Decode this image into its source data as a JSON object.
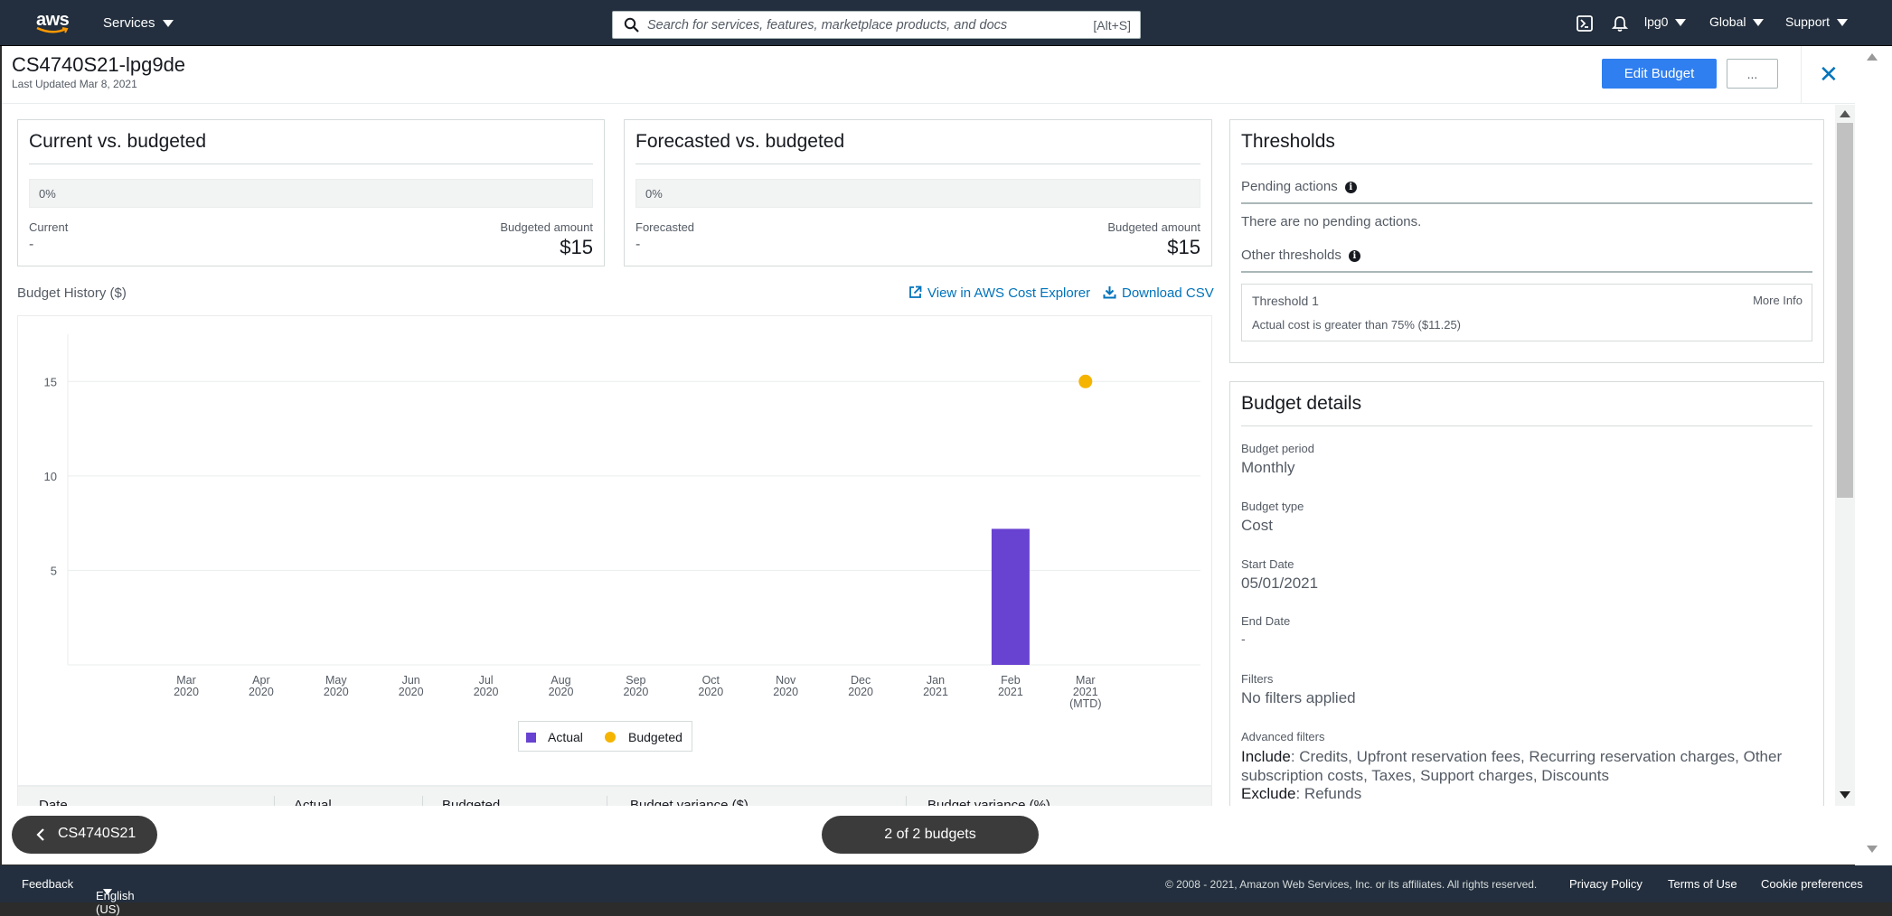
{
  "nav": {
    "logo": "aws",
    "services": "Services",
    "search_placeholder": "Search for services, features, marketplace products, and docs",
    "search_shortcut": "[Alt+S]",
    "account": "lpg0",
    "region": "Global",
    "support": "Support"
  },
  "header": {
    "title": "CS4740S21-lpg9de",
    "last_updated": "Last Updated Mar 8, 2021",
    "edit_button": "Edit Budget",
    "more_button": "..."
  },
  "current_card": {
    "title": "Current vs. budgeted",
    "progress": "0%",
    "current_label": "Current",
    "current_value": "-",
    "budget_label": "Budgeted amount",
    "budget_value": "$15"
  },
  "forecast_card": {
    "title": "Forecasted vs. budgeted",
    "progress": "0%",
    "forecast_label": "Forecasted",
    "forecast_value": "-",
    "budget_label": "Budgeted amount",
    "budget_value": "$15"
  },
  "history": {
    "title": "Budget History ($)",
    "explorer_link": "View in AWS Cost Explorer",
    "csv_link": "Download CSV"
  },
  "chart_data": {
    "type": "bar",
    "categories": [
      "Mar 2020",
      "Apr 2020",
      "May 2020",
      "Jun 2020",
      "Jul 2020",
      "Aug 2020",
      "Sep 2020",
      "Oct 2020",
      "Nov 2020",
      "Dec 2020",
      "Jan 2021",
      "Feb 2021",
      "Mar 2021 (MTD)"
    ],
    "category_lines": [
      [
        "Mar",
        "2020"
      ],
      [
        "Apr",
        "2020"
      ],
      [
        "May",
        "2020"
      ],
      [
        "Jun",
        "2020"
      ],
      [
        "Jul",
        "2020"
      ],
      [
        "Aug",
        "2020"
      ],
      [
        "Sep",
        "2020"
      ],
      [
        "Oct",
        "2020"
      ],
      [
        "Nov",
        "2020"
      ],
      [
        "Dec",
        "2020"
      ],
      [
        "Jan",
        "2021"
      ],
      [
        "Feb",
        "2021"
      ],
      [
        "Mar",
        "2021",
        "(MTD)"
      ]
    ],
    "series": [
      {
        "name": "Actual",
        "type": "bar",
        "color": "#6842d1",
        "values": [
          null,
          null,
          null,
          null,
          null,
          null,
          null,
          null,
          null,
          null,
          null,
          7.2,
          null
        ]
      },
      {
        "name": "Budgeted",
        "type": "scatter",
        "color": "#f5b400",
        "values": [
          null,
          null,
          null,
          null,
          null,
          null,
          null,
          null,
          null,
          null,
          null,
          null,
          15
        ]
      }
    ],
    "yticks": [
      5,
      10,
      15
    ],
    "ylim": [
      0,
      17.5
    ],
    "grid": true,
    "legend": "bottom-center"
  },
  "table": {
    "columns": [
      "Date",
      "Actual",
      "Budgeted",
      "Budget variance ($)",
      "Budget variance (%)"
    ]
  },
  "thresholds": {
    "title": "Thresholds",
    "pending_label": "Pending actions",
    "pending_text": "There are no pending actions.",
    "other_label": "Other thresholds",
    "threshold_name": "Threshold 1",
    "more_info": "More Info",
    "threshold_desc": "Actual cost is greater than 75% ($11.25)"
  },
  "details": {
    "title": "Budget details",
    "period_label": "Budget period",
    "period_value": "Monthly",
    "type_label": "Budget type",
    "type_value": "Cost",
    "start_label": "Start Date",
    "start_value": "05/01/2021",
    "end_label": "End Date",
    "end_value": "-",
    "filters_label": "Filters",
    "filters_value": "No filters applied",
    "adv_label": "Advanced filters",
    "include_label": "Include",
    "include_value": ": Credits, Upfront reservation fees, Recurring reservation charges, Other subscription costs, Taxes, Support charges, Discounts",
    "exclude_label": "Exclude",
    "exclude_value": ": Refunds"
  },
  "pager": {
    "back_label": "CS4740S21",
    "count": "2 of 2 budgets"
  },
  "footer": {
    "feedback": "Feedback",
    "language": "English (US)",
    "copyright": "© 2008 - 2021, Amazon Web Services, Inc. or its affiliates. All rights reserved.",
    "privacy": "Privacy Policy",
    "terms": "Terms of Use",
    "cookies": "Cookie preferences"
  }
}
